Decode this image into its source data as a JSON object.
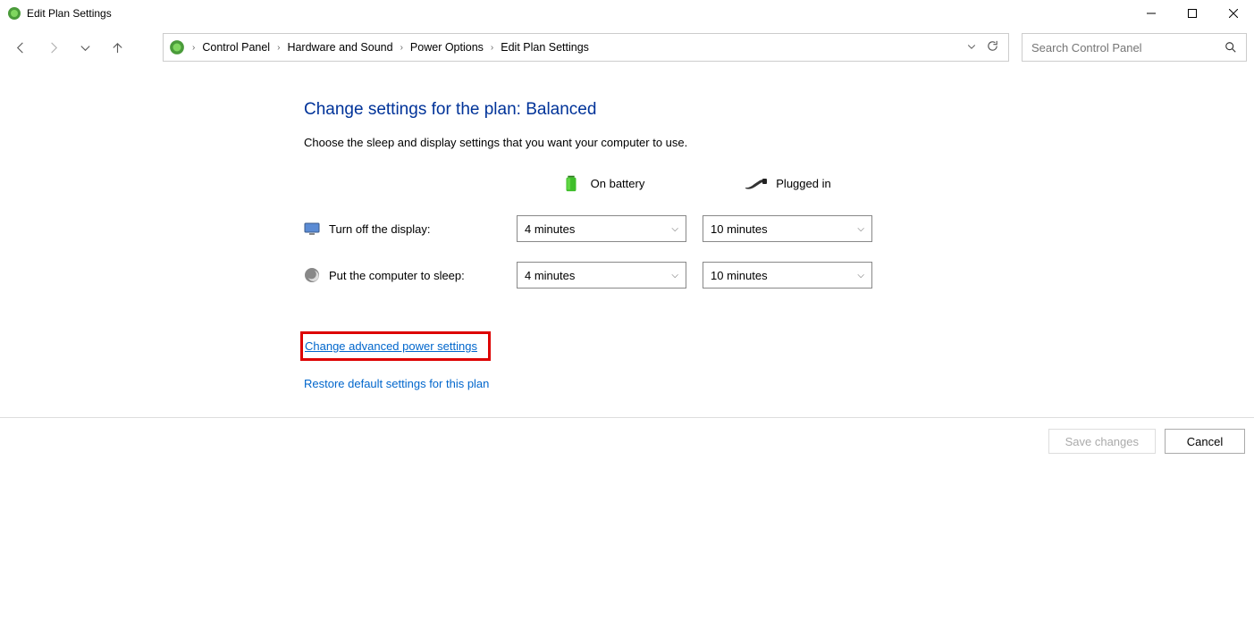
{
  "window": {
    "title": "Edit Plan Settings"
  },
  "breadcrumb": {
    "items": [
      "Control Panel",
      "Hardware and Sound",
      "Power Options",
      "Edit Plan Settings"
    ]
  },
  "search": {
    "placeholder": "Search Control Panel"
  },
  "main": {
    "heading": "Change settings for the plan: Balanced",
    "subtext": "Choose the sleep and display settings that you want your computer to use.",
    "col_battery": "On battery",
    "col_plugged": "Plugged in",
    "row_display": "Turn off the display:",
    "row_sleep": "Put the computer to sleep:",
    "dropdowns": {
      "display_battery": "4 minutes",
      "display_plugged": "10 minutes",
      "sleep_battery": "4 minutes",
      "sleep_plugged": "10 minutes"
    },
    "link_advanced": "Change advanced power settings",
    "link_restore": "Restore default settings for this plan"
  },
  "buttons": {
    "save": "Save changes",
    "cancel": "Cancel"
  }
}
